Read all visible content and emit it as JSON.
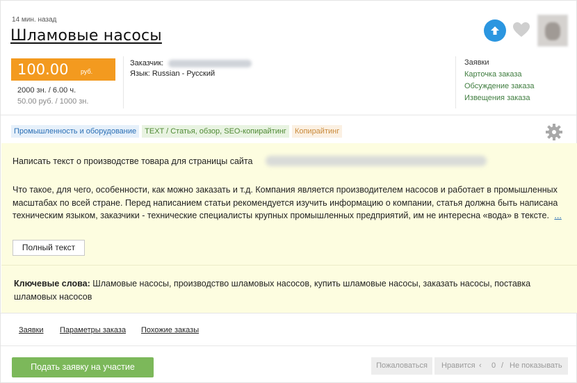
{
  "order": {
    "time_ago": "14 мин. назад",
    "title": "Шламовые насосы"
  },
  "price": {
    "value": "100.00",
    "currency": "руб.",
    "volume": "2000 зн.  / 6.00 ч.",
    "rate": "50.00 руб.  / 1000 зн."
  },
  "meta": {
    "customer_label": "Заказчик:",
    "language": "Язык: Russian - Русский"
  },
  "right_links": [
    "Заявки",
    "Карточка заказа",
    "Обсуждение заказа",
    "Извещения заказа"
  ],
  "tags": [
    {
      "label": "Промышленность и оборудование",
      "color": "#2a6fb5"
    },
    {
      "label": "TEXT / Статья, обзор, SEO-копирайтинг",
      "color": "#4f8a35"
    },
    {
      "label": "Копирайтинг",
      "color": "#c98a3b"
    }
  ],
  "description": {
    "line1": "Написать текст о производстве товара для страницы сайта",
    "paragraph": "Что такое, для чего, особенности, как можно заказать и т.д. Компания является производителем насосов и работает в промышленных масштабах по всей стране. Перед написанием статьи рекомендуется изучить информацию о компании, статья должна быть написана техническим языком, заказчики - технические специалисты крупных промышленных предприятий, им не интересна «вода» в тексте.",
    "more": "...",
    "full_text_button": "Полный текст"
  },
  "keywords": {
    "label": "Ключевые слова:",
    "value": "Шламовые насосы, производство шламовых насосов, купить шламовые насосы, заказать насосы, поставка шламовых насосов"
  },
  "bottom_links": [
    "Заявки",
    "Параметры заказа",
    "Похожие заказы"
  ],
  "actions": {
    "apply": "Подать заявку на участие",
    "report": "Пожаловаться",
    "like": "Нравится",
    "like_count": "0",
    "hide": "Не показывать"
  },
  "colors": {
    "accent_orange": "#f39a1f",
    "accent_blue": "#2b96e0",
    "apply_green": "#7cb85a",
    "desc_bg": "#fdfde0"
  },
  "icons": [
    "arrow-up-icon",
    "heart-icon",
    "gear-icon"
  ]
}
